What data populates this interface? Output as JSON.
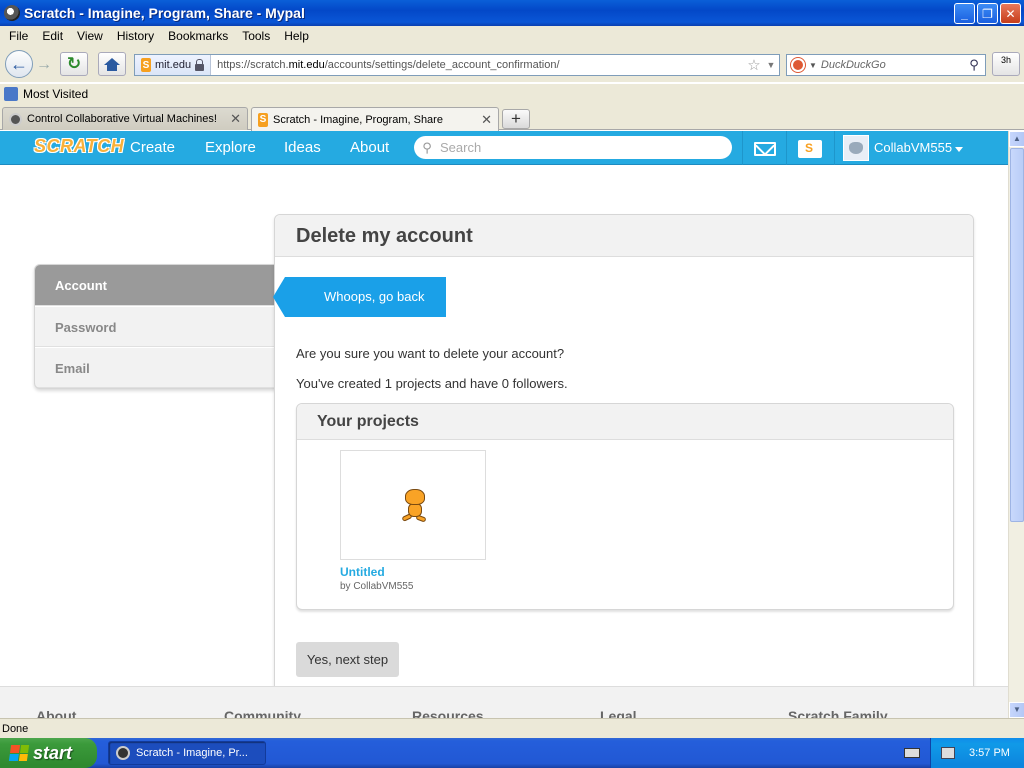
{
  "window": {
    "title": "Scratch - Imagine, Program, Share - Mypal",
    "minimize": "_",
    "restore": "❐",
    "close": "✕"
  },
  "menu": [
    "File",
    "Edit",
    "View",
    "History",
    "Bookmarks",
    "Tools",
    "Help"
  ],
  "nav": {
    "identity": "mit.edu",
    "url_prefix": "https://scratch.",
    "url_domain": "mit.edu",
    "url_path": "/accounts/settings/delete_account_confirmation/",
    "search_placeholder": "DuckDuckGo",
    "addon_label": "3h"
  },
  "bookmarks": {
    "most_visited": "Most Visited"
  },
  "tabs": [
    {
      "label": "Control Collaborative Virtual Machines!",
      "active": false
    },
    {
      "label": "Scratch - Imagine, Program, Share",
      "active": true
    }
  ],
  "newtab": "+",
  "scratch": {
    "logo": "SCRATCH",
    "links": [
      "Create",
      "Explore",
      "Ideas",
      "About"
    ],
    "search_placeholder": "Search",
    "username": "CollabVM555"
  },
  "settings_menu": [
    {
      "label": "Account",
      "active": true
    },
    {
      "label": "Password",
      "active": false
    },
    {
      "label": "Email",
      "active": false
    }
  ],
  "main": {
    "title": "Delete my account",
    "back_button": "Whoops, go back",
    "question": "Are you sure you want to delete your account?",
    "stats": "You've created 1 projects and have 0 followers.",
    "projects_header": "Your projects",
    "project": {
      "title": "Untitled",
      "author": "by CollabVM555"
    },
    "next_button": "Yes, next step"
  },
  "footer": [
    "About",
    "Community",
    "Resources",
    "Legal",
    "Scratch Family"
  ],
  "status": "Done",
  "taskbar": {
    "start": "start",
    "task": "Scratch - Imagine, Pr...",
    "clock": "3:57 PM"
  },
  "colors": {
    "scratch_blue": "#25aae1",
    "back_button_blue": "#1aa0e8",
    "project_link": "#25aae1"
  }
}
